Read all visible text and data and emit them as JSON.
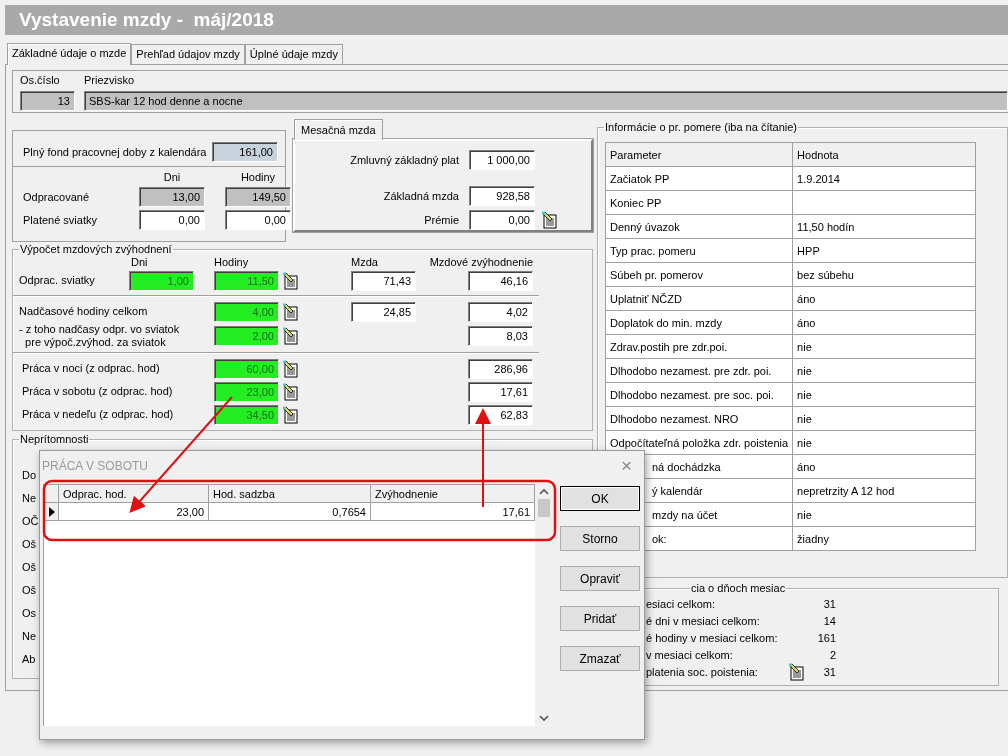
{
  "window": {
    "title": "Vystavenie mzdy -  máj/2018"
  },
  "tabs": [
    {
      "label": "Základné údaje o mzde",
      "selected": true
    },
    {
      "label": "Prehľad údajov mzdy",
      "selected": false
    },
    {
      "label": "Úplné údaje mzdy",
      "selected": false
    }
  ],
  "employee": {
    "number_label": "Os.číslo",
    "number": "13",
    "name_label": "Priezvisko",
    "name": "SBS-kar 12 hod denne a nocne"
  },
  "fund": {
    "label": "Plný fond pracovnej doby z kalendára",
    "value": "161,00",
    "columns": [
      "Dni",
      "Hodiny"
    ],
    "rows": [
      {
        "label": "Odpracované",
        "values": [
          "13,00",
          "149,50"
        ],
        "kind": "readonly"
      },
      {
        "label": "Platené sviatky",
        "values": [
          "0,00",
          "0,00"
        ],
        "kind": "editable"
      }
    ]
  },
  "monthly": {
    "tab": "Mesačná mzda",
    "rows": [
      {
        "label": "Zmluvný základný plat",
        "value": "1 000,00",
        "calc_icon": false
      },
      {
        "label": "Základná mzda",
        "value": "928,58",
        "calc_icon": false
      },
      {
        "label": "Prémie",
        "value": "0,00",
        "calc_icon": true
      }
    ]
  },
  "bonuses": {
    "title": "Výpočet mzdových zvýhodnení",
    "columns": [
      "Dni",
      "Hodiny",
      "Mzda",
      "Mzdové zvýhodnenie"
    ],
    "sections": [
      {
        "rows": [
          {
            "label": "Odprac. sviatky",
            "dni": "1,00",
            "hodiny": "11,50",
            "mzda": "71,43",
            "bonus": "46,16"
          }
        ]
      },
      {
        "rows": [
          {
            "label": "Nadčasové hodiny celkom",
            "hodiny": "4,00",
            "mzda": "24,85",
            "bonus": "4,02"
          },
          {
            "label": "- z toho nadčasy odpr. vo sviatok\n  pre výpoč.zvýhod. za sviatok",
            "hodiny": "2,00",
            "bonus": "8,03"
          }
        ]
      },
      {
        "rows": [
          {
            "label": "Práca v noci (z odprac. hod)",
            "hodiny": "60,00",
            "bonus": "286,96"
          },
          {
            "label": "Práca v sobotu (z odprac. hod)",
            "hodiny": "23,00",
            "bonus": "17,61"
          },
          {
            "label": "Práca v nedeľu (z odprac. hod)",
            "hodiny": "34,50",
            "bonus": "62,83"
          }
        ]
      }
    ]
  },
  "absences": {
    "title": "Neprítomnosti",
    "labels": [
      "Do",
      "Ne",
      "OČ",
      "Oš",
      "Oš",
      "Oš",
      "Os",
      "Ne",
      "Ab"
    ]
  },
  "info": {
    "title": "Informácie o pr. pomere (iba na čítanie)",
    "columns": [
      "Parameter",
      "Hodnota"
    ],
    "rows": [
      {
        "parameter": "Začiatok PP",
        "value": "1.9.2014",
        "cut": false
      },
      {
        "parameter": "Koniec PP",
        "cut": false
      },
      {
        "parameter": "Denný úvazok",
        "value": "11,50 hodín",
        "cut": false
      },
      {
        "parameter": "Typ prac. pomeru",
        "value": "HPP",
        "cut": false
      },
      {
        "parameter": "Súbeh pr. pomerov",
        "value": "bez súbehu",
        "cut": false
      },
      {
        "parameter": "Uplatniť NČZD",
        "value": "áno",
        "cut": false
      },
      {
        "parameter": "Doplatok do min. mzdy",
        "value": "áno",
        "cut": false
      },
      {
        "parameter": "Zdrav.postih pre zdr.poi.",
        "value": "nie",
        "cut": false
      },
      {
        "parameter": "Dlhodobo nezamest. pre zdr. poi.",
        "value": "nie",
        "cut": false
      },
      {
        "parameter": "Dlhodobo nezamest. pre soc. poi.",
        "value": "nie",
        "cut": false
      },
      {
        "parameter": "Dlhodobo nezamest. NRO",
        "value": "nie",
        "cut": false
      },
      {
        "parameter": "Odpočítateľná položka zdr. poistenia",
        "value": "nie",
        "cut": false
      },
      {
        "parameter": "ná dochádzka",
        "value": "áno",
        "cut": true
      },
      {
        "parameter": "ý kalendár",
        "value": "nepretrzity A 12 hod",
        "cut": true
      },
      {
        "parameter": "mzdy na účet",
        "value": "nie",
        "cut": true
      },
      {
        "parameter": "ok:",
        "value": "žiadny",
        "cut": true
      }
    ]
  },
  "days": {
    "title": "cia o dňoch mesiac",
    "rows": [
      {
        "label": "esiaci celkom:",
        "value": "31",
        "calc_icon": false
      },
      {
        "label": "é dni v mesiaci celkom:",
        "value": "14",
        "calc_icon": false
      },
      {
        "label": "é hodiny v mesiaci celkom:",
        "value": "161",
        "calc_icon": false
      },
      {
        "label": "v mesiaci celkom:",
        "value": "2",
        "calc_icon": false
      },
      {
        "label": "platenia soc. poistenia:",
        "value": "31",
        "calc_icon": true
      }
    ]
  },
  "dialog": {
    "title": "PRÁCA V SOBOTU",
    "close": "×",
    "columns": [
      "Odprac. hod.",
      "Hod. sadzba",
      "Zvýhodnenie"
    ],
    "rows": [
      {
        "values": [
          "23,00",
          "0,7654",
          "17,61"
        ],
        "selected": true
      }
    ],
    "buttons": [
      {
        "label": "OK",
        "default": true
      },
      {
        "label": "Storno",
        "default": false
      },
      {
        "label": "Opraviť",
        "default": false
      },
      {
        "label": "Pridať",
        "default": false
      },
      {
        "label": "Zmazať",
        "default": false
      }
    ]
  }
}
